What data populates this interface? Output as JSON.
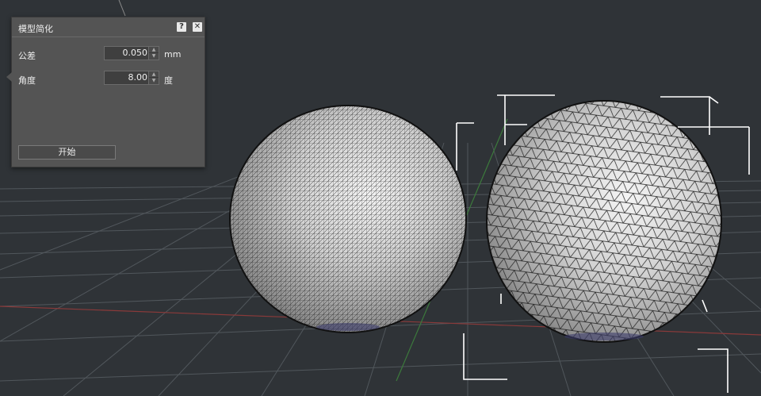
{
  "dialog": {
    "title": "模型简化",
    "help_label": "?",
    "close_label": "✕",
    "tolerance": {
      "label": "公差",
      "value": "0.050",
      "unit": "mm"
    },
    "angle": {
      "label": "角度",
      "value": "8.00",
      "unit": "度"
    },
    "start_label": "开始"
  },
  "viewport": {
    "background_color": "#2f3337",
    "grid_color": "#51575c",
    "x_axis_color": "#8a3a3a",
    "y_axis_color": "#3c7a3c",
    "selection_box_color": "#ffffff",
    "sphere_fill": "#bdbdbd",
    "mesh_color": "#1c1c1c"
  }
}
